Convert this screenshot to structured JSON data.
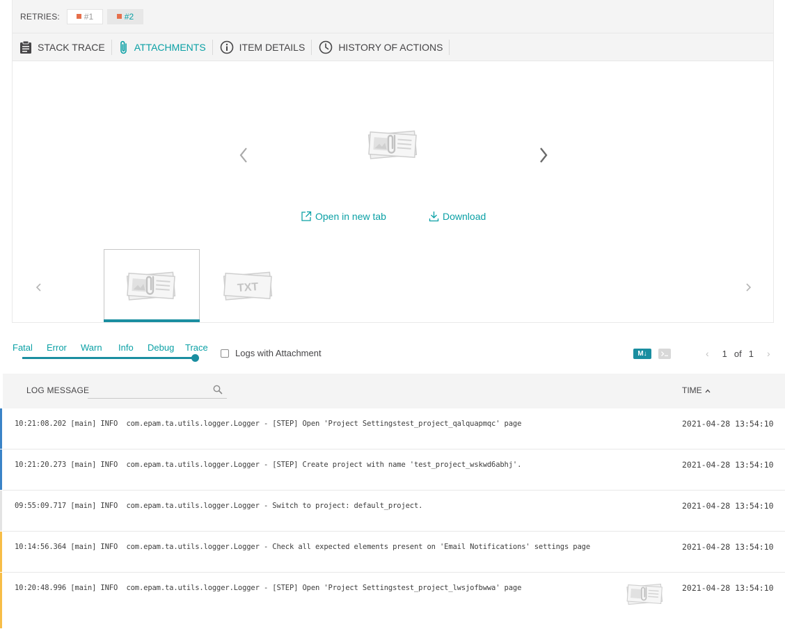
{
  "retries": {
    "label": "RETRIES:",
    "items": [
      {
        "label": "#1",
        "color": "#e66f4b",
        "active": false
      },
      {
        "label": "#2",
        "color": "#e66f4b",
        "active": true
      }
    ]
  },
  "tabs": [
    {
      "label": "STACK TRACE",
      "icon": "clipboard-icon",
      "active": false
    },
    {
      "label": "ATTACHMENTS",
      "icon": "paperclip-icon",
      "active": true
    },
    {
      "label": "ITEM DETAILS",
      "icon": "info-icon",
      "active": false
    },
    {
      "label": "HISTORY OF ACTIONS",
      "icon": "clock-icon",
      "active": false
    }
  ],
  "viewer": {
    "open_label": "Open in new tab",
    "download_label": "Download",
    "thumbnails": [
      {
        "type": "image-attachment",
        "active": true
      },
      {
        "type": "text-attachment",
        "label": "TXT",
        "active": false
      }
    ]
  },
  "filters": {
    "levels": [
      "Fatal",
      "Error",
      "Warn",
      "Info",
      "Debug",
      "Trace"
    ],
    "selected_level": "Trace",
    "attachment_checkbox_label": "Logs with Attachment",
    "markdown_label": "M↓",
    "pager": {
      "current": "1",
      "of_label": "of",
      "total": "1"
    }
  },
  "log_table": {
    "message_header": "LOG MESSAGE",
    "search_placeholder": "",
    "time_header": "TIME",
    "rows": [
      {
        "message": "10:21:08.202 [main] INFO  com.epam.ta.utils.logger.Logger - [STEP] Open 'Project Settingstest_project_qalquapmqc' page",
        "time": "2021-04-28 13:54:10",
        "level_color": "#3a83c7",
        "attachment": false
      },
      {
        "message": "10:21:20.273 [main] INFO  com.epam.ta.utils.logger.Logger - [STEP] Create project with name 'test_project_wskwd6abhj'.",
        "time": "2021-04-28 13:54:10",
        "level_color": "#3a83c7",
        "attachment": false
      },
      {
        "message": "09:55:09.717 [main] INFO  com.epam.ta.utils.logger.Logger - Switch to project: default_project.",
        "time": "2021-04-28 13:54:10",
        "level_color": "#e3e3e3",
        "attachment": false
      },
      {
        "message": "10:14:56.364 [main] INFO  com.epam.ta.utils.logger.Logger - Check all expected elements present on 'Email Notifications' settings page",
        "time": "2021-04-28 13:54:10",
        "level_color": "#f7bd47",
        "attachment": false
      },
      {
        "message": "10:20:48.996 [main] INFO  com.epam.ta.utils.logger.Logger - [STEP] Open 'Project Settingstest_project_lwsjofbwwa' page",
        "time": "2021-04-28 13:54:10",
        "level_color": "#f7bd47",
        "attachment": true
      }
    ]
  },
  "colors": {
    "accent": "#0aa0a5",
    "accent_dark": "#1a8ea0",
    "retry_failed": "#e66f4b"
  }
}
